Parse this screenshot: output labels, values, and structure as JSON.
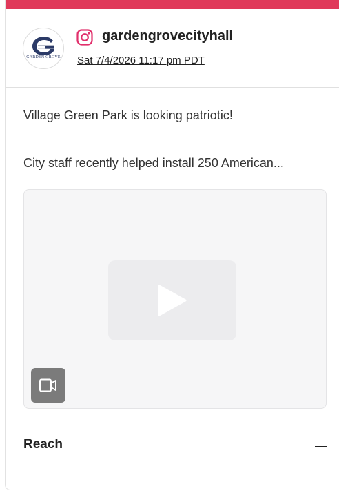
{
  "post": {
    "platform_icon": "instagram-icon",
    "account_name": "gardengrovecityhall",
    "avatar_caption": "GARDEN GROVE",
    "date": "Sat 7/4/2026 11:17 pm PDT",
    "text_line_1": "Village Green Park is looking patriotic!",
    "text_line_2": "City staff recently helped install 250 American..."
  },
  "media": {
    "type_icon": "video-camera-icon",
    "play_icon": "play-icon"
  },
  "reach": {
    "label": "Reach",
    "toggle_icon": "minus-icon"
  },
  "colors": {
    "accent": "#e0395a",
    "instagram": "#e1306c",
    "logo_blue": "#2b3a67"
  }
}
